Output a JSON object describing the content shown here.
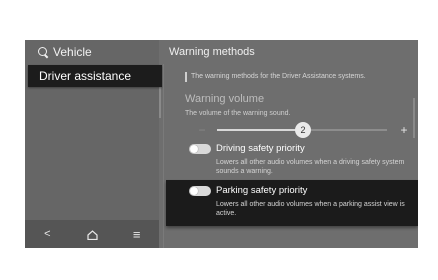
{
  "left_panel": {
    "search_label": "Vehicle",
    "menu_items": [
      {
        "label": "Driver assistance",
        "selected": true
      }
    ],
    "bottom_nav": {
      "back": "<",
      "home": "home-icon",
      "menu": "≡"
    }
  },
  "right_panel": {
    "title": "Warning methods",
    "description": "The warning methods for the Driver Assistance systems.",
    "volume": {
      "title": "Warning volume",
      "subtitle": "The volume of the warning sound.",
      "value": "2",
      "minus": "−",
      "plus": "+"
    },
    "options": [
      {
        "title": "Driving safety priority",
        "description": "Lowers all other audio volumes when a driving safety system sounds a warning.",
        "enabled": false
      },
      {
        "title": "Parking safety priority",
        "description": "Lowers all other audio volumes when a parking assist view is active.",
        "enabled": false,
        "highlighted": true
      }
    ]
  },
  "colors": {
    "screen_bg": "#6e6e6e",
    "selected_bg": "#1c1c1c",
    "highlight_bg": "#1b1b1b"
  }
}
